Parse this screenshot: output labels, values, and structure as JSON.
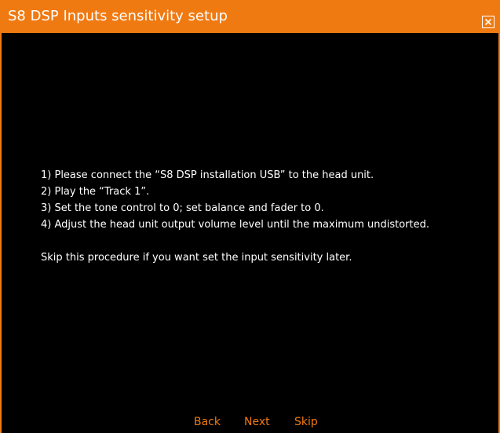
{
  "window": {
    "title": "S8 DSP Inputs sensitivity setup",
    "close_icon": "close-icon",
    "accent_color": "#f07a12",
    "background_color": "#000000",
    "text_color": "#ffffff"
  },
  "instructions": {
    "steps": [
      "1) Please connect the “S8 DSP installation USB” to the head unit.",
      "2) Play the “Track 1”.",
      "3) Set the tone control to 0; set balance and fader to 0.",
      "4) Adjust the head unit output volume level until the maximum undistorted."
    ],
    "note": "Skip this procedure if you want set the input sensitivity later."
  },
  "actions": {
    "back_label": "Back",
    "next_label": "Next",
    "skip_label": "Skip"
  }
}
